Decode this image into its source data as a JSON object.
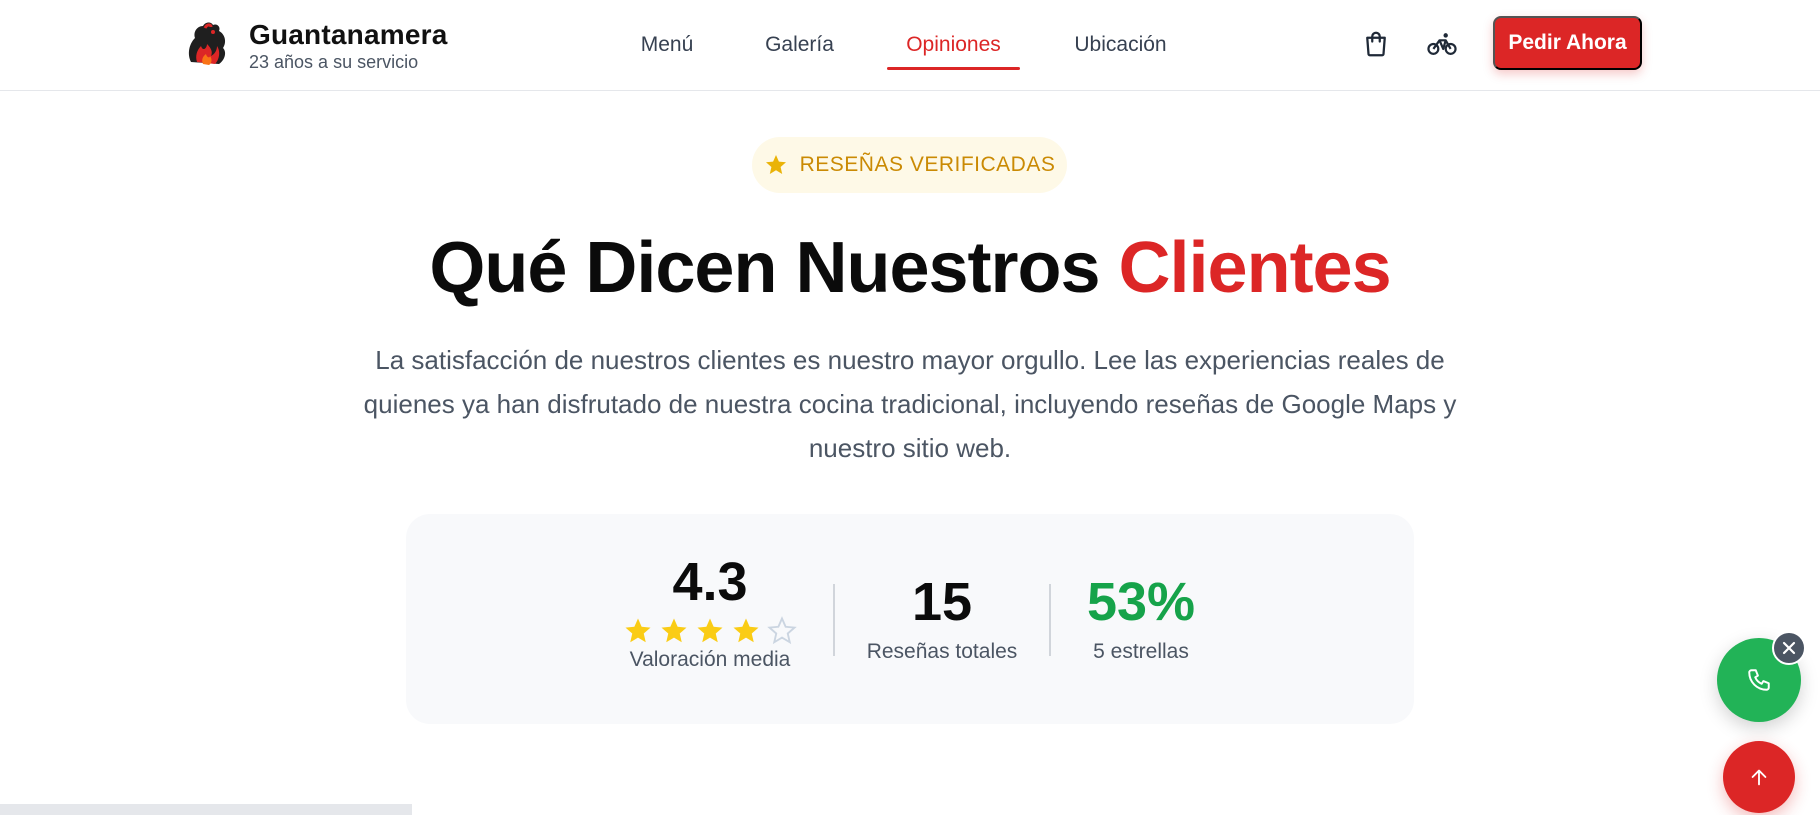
{
  "header": {
    "brand_name": "Guantanamera",
    "brand_tagline": "23 años a su servicio",
    "logo_icon": "rooster-flame-logo",
    "nav": [
      {
        "label": "Menú",
        "active": false
      },
      {
        "label": "Galería",
        "active": false
      },
      {
        "label": "Opiniones",
        "active": true
      },
      {
        "label": "Ubicación",
        "active": false
      }
    ],
    "cart_icon": "shopping-bag-icon",
    "delivery_icon": "bicycle-icon",
    "order_label": "Pedir Ahora"
  },
  "hero": {
    "badge_icon": "star-icon",
    "badge_label": "RESEÑAS VERIFICADAS",
    "title_main": "Qué Dicen Nuestros ",
    "title_accent": "Clientes",
    "subtitle": "La satisfacción de nuestros clientes es nuestro mayor orgullo. Lee las experiencias reales de quienes ya han disfrutado de nuestra cocina tradicional, incluyendo reseñas de Google Maps y nuestro sitio web."
  },
  "stats": {
    "rating_value": "4.3",
    "rating_stars_filled": 4,
    "rating_stars_total": 5,
    "rating_label": "Valoración media",
    "total_value": "15",
    "total_label": "Reseñas totales",
    "five_star_value": "53%",
    "five_star_label": "5 estrellas"
  },
  "floating": {
    "call_icon": "phone-icon",
    "close_icon": "close-icon",
    "top_icon": "arrow-up-icon"
  },
  "colors": {
    "accent": "#dc2626",
    "green": "#16a34a",
    "star": "#facc15",
    "badge_text": "#ca8a04"
  }
}
